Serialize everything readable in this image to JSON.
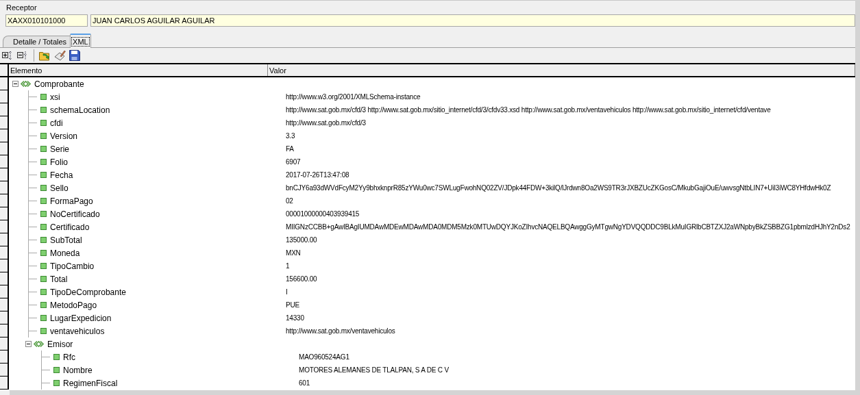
{
  "receptor": {
    "label": "Receptor",
    "rfc": "XAXX010101000",
    "name": "JUAN CARLOS AGUILAR AGUILAR"
  },
  "tabs": [
    {
      "label": "Detalle / Totales",
      "selected": false
    },
    {
      "label": "XML",
      "selected": true
    }
  ],
  "tree": {
    "columns": [
      "Elemento",
      "Valor"
    ],
    "nodes": [
      {
        "kind": "element",
        "name": "Comprobante",
        "expanded": true,
        "children": [
          {
            "kind": "attribute",
            "name": "xsi",
            "value": "http://www.w3.org/2001/XMLSchema-instance"
          },
          {
            "kind": "attribute",
            "name": "schemaLocation",
            "value": "http://www.sat.gob.mx/cfd/3 http://www.sat.gob.mx/sitio_internet/cfd/3/cfdv33.xsd http://www.sat.gob.mx/ventavehiculos http://www.sat.gob.mx/sitio_internet/cfd/ventave"
          },
          {
            "kind": "attribute",
            "name": "cfdi",
            "value": "http://www.sat.gob.mx/cfd/3"
          },
          {
            "kind": "attribute",
            "name": "Version",
            "value": "3.3"
          },
          {
            "kind": "attribute",
            "name": "Serie",
            "value": "FA"
          },
          {
            "kind": "attribute",
            "name": "Folio",
            "value": "6907"
          },
          {
            "kind": "attribute",
            "name": "Fecha",
            "value": "2017-07-26T13:47:08"
          },
          {
            "kind": "attribute",
            "name": "Sello",
            "value": "bnCJY6a93dWVdFcyM2Yy9bhxknprR85zYWu0wc7SWLugFwohNQ02ZV/JDpk44FDW+3kilQ/lJrdwn8Oa2WS9TR3rJXBZUcZKGosC/MkubGajiOuE/uwvsgNtbLIN7+UiI3iWC8YHfdwHk0Z"
          },
          {
            "kind": "attribute",
            "name": "FormaPago",
            "value": "02"
          },
          {
            "kind": "attribute",
            "name": "NoCertificado",
            "value": "00001000000403939415"
          },
          {
            "kind": "attribute",
            "name": "Certificado",
            "value": "MIIGNzCCBB+gAwIBAgIUMDAwMDEwMDAwMDA0MDM5Mzk0MTUwDQYJKoZIhvcNAQELBQAwggGyMTgwNgYDVQQDDC9BLkMuIGRlbCBTZXJ2aWNpbyBkZSBBZG1pbmlzdHJhY2nDs2"
          },
          {
            "kind": "attribute",
            "name": "SubTotal",
            "value": "135000.00"
          },
          {
            "kind": "attribute",
            "name": "Moneda",
            "value": "MXN"
          },
          {
            "kind": "attribute",
            "name": "TipoCambio",
            "value": "1"
          },
          {
            "kind": "attribute",
            "name": "Total",
            "value": "156600.00"
          },
          {
            "kind": "attribute",
            "name": "TipoDeComprobante",
            "value": "I"
          },
          {
            "kind": "attribute",
            "name": "MetodoPago",
            "value": "PUE"
          },
          {
            "kind": "attribute",
            "name": "LugarExpedicion",
            "value": "14330"
          },
          {
            "kind": "attribute",
            "name": "ventavehiculos",
            "value": "http://www.sat.gob.mx/ventavehiculos"
          },
          {
            "kind": "element",
            "name": "Emisor",
            "expanded": true,
            "children": [
              {
                "kind": "attribute",
                "name": "Rfc",
                "value": "MAO960524AG1"
              },
              {
                "kind": "attribute",
                "name": "Nombre",
                "value": "MOTORES ALEMANES DE TLALPAN, S A  DE C V"
              },
              {
                "kind": "attribute",
                "name": "RegimenFiscal",
                "value": "601"
              }
            ]
          }
        ]
      }
    ]
  }
}
